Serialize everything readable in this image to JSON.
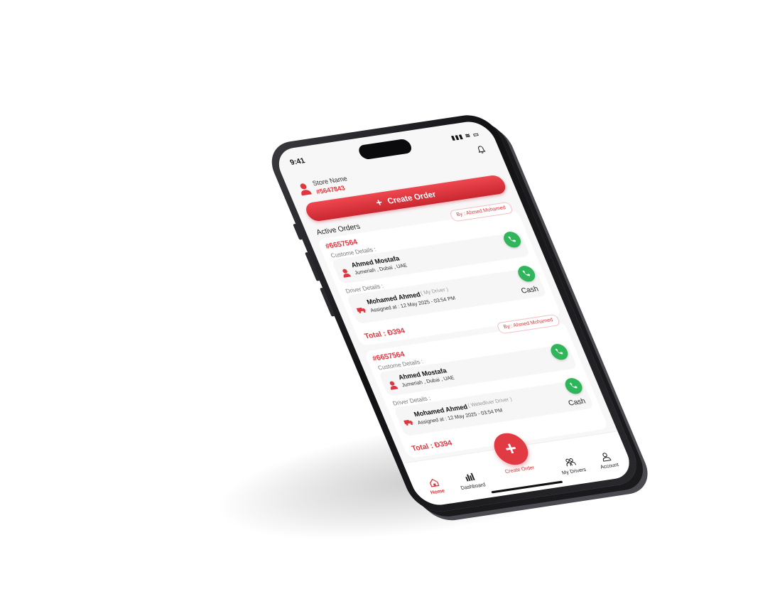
{
  "status_bar": {
    "time": "9:41",
    "icons": "▮▮▮ ≋ ▭"
  },
  "header": {
    "store_name": "Store Name",
    "store_id": "#5647843"
  },
  "create_button": {
    "label": "Create Order"
  },
  "section": {
    "title": "Active Orders"
  },
  "orders": [
    {
      "by": "By : Ahmed Mohamed",
      "id": "#6657564",
      "customer_label": "Custome Details :",
      "customer_name": "Ahmed Mostafa",
      "customer_location": "Jumeriah , Dubai , UAE",
      "driver_label": "Driver Details :",
      "driver_name": "Mohamed Ahmed",
      "driver_tag": "( My Driver )",
      "assigned": "Assigned at : 12 May 2025 - 03:54 PM",
      "payment": "Cash",
      "total": "Total : Ð394"
    },
    {
      "by": "By : Ahmed Mohamed",
      "id": "#6657564",
      "customer_label": "Custome Details :",
      "customer_name": "Ahmed Mostafa",
      "customer_location": "Jumeriah , Dubai , UAE",
      "driver_label": "Driver Details :",
      "driver_name": "Mohamed Ahmed",
      "driver_tag": "( Weledliver Driver )",
      "assigned": "Assigned at : 12 May 2025 - 03:54 PM",
      "payment": "Cash",
      "total": "Total : Ð394"
    }
  ],
  "tabbar": {
    "home": "Home",
    "dashboard": "Dashboard",
    "create_order": "Create Order",
    "my_drivers": "My Drivers",
    "account": "Account",
    "fab_symbol": "+"
  },
  "colors": {
    "accent": "#e0363f",
    "call_green": "#2fb55a"
  }
}
